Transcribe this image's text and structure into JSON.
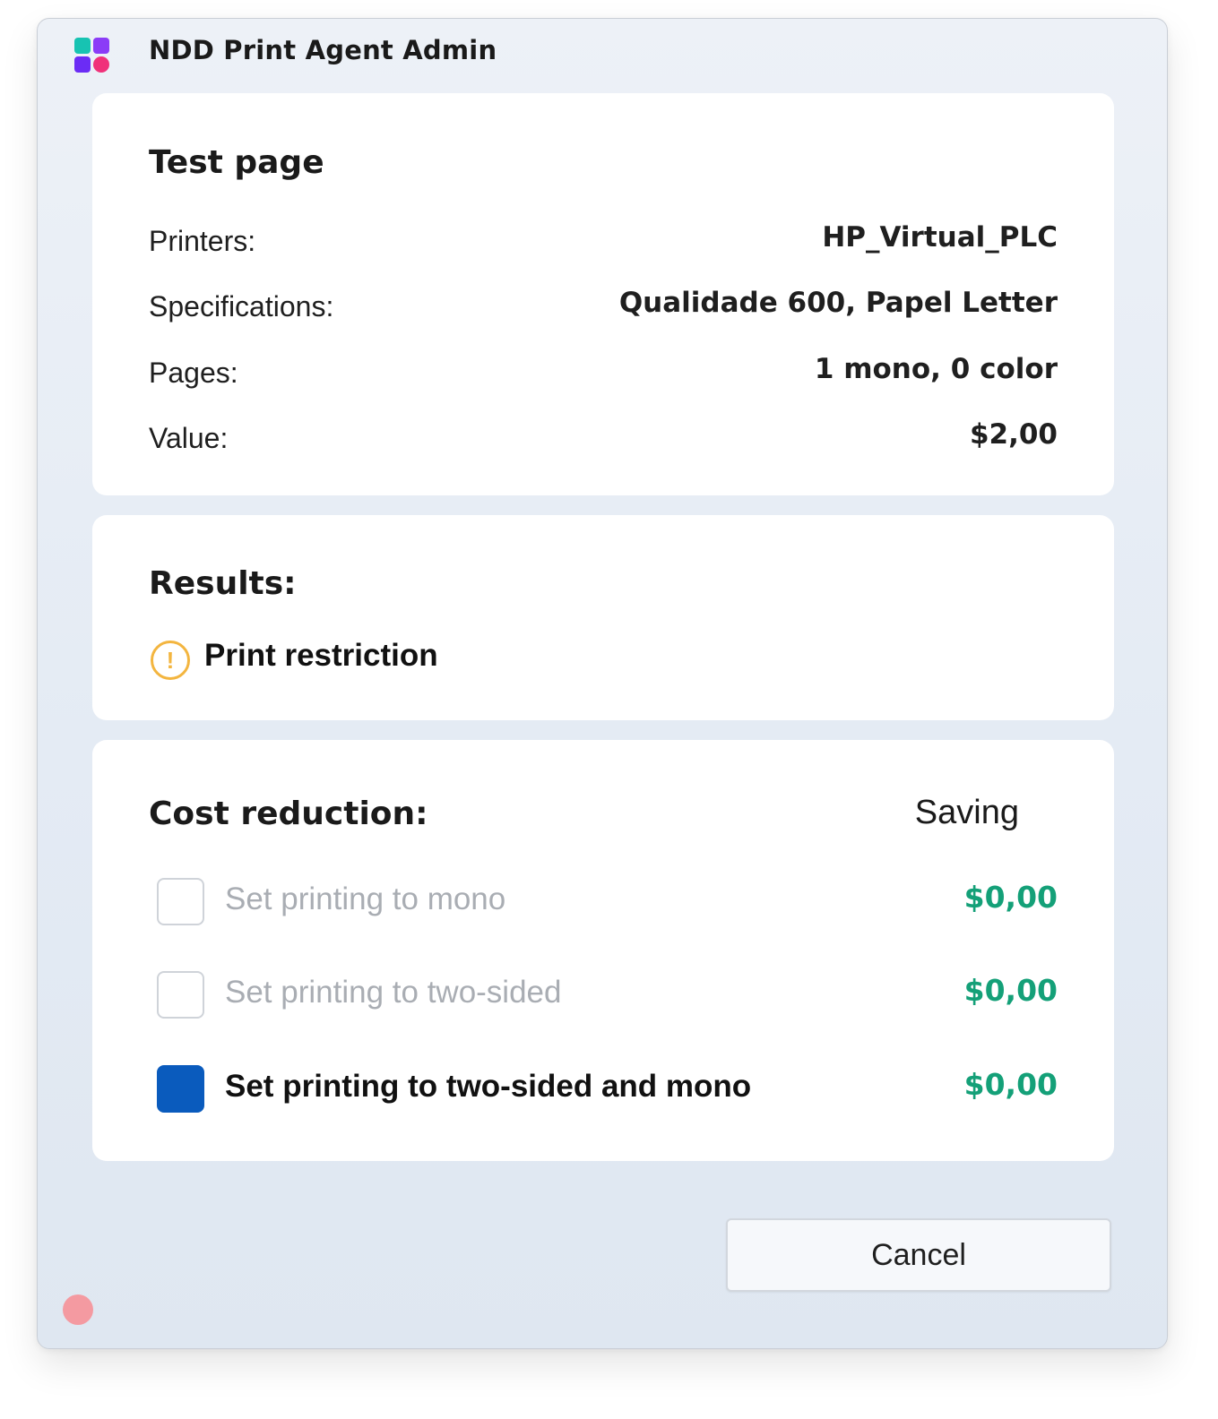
{
  "app": {
    "title": "NDD Print  Agent Admin",
    "icon": "ndd-logo-icon"
  },
  "test_page": {
    "title": "Test page",
    "rows": [
      {
        "label": "Printers:",
        "value": "HP_Virtual_PLC"
      },
      {
        "label": "Specifications:",
        "value": "Qualidade 600, Papel Letter"
      },
      {
        "label": "Pages:",
        "value": "1 mono, 0 color"
      },
      {
        "label": "Value:",
        "value": "$2,00"
      }
    ]
  },
  "results": {
    "title": "Results:",
    "icon": "warning-icon",
    "icon_glyph": "!",
    "status_text": "Print restriction",
    "status_color": "#f3b53f"
  },
  "cost_reduction": {
    "title": "Cost reduction:",
    "saving_header": "Saving",
    "options": [
      {
        "label": "Set printing to mono",
        "saving": "$0,00",
        "checked": false
      },
      {
        "label": "Set printing to two-sided",
        "saving": "$0,00",
        "checked": false
      },
      {
        "label": "Set printing to two-sided and mono",
        "saving": "$0,00",
        "checked": true
      }
    ],
    "saving_color": "#14a078",
    "checked_color": "#0a5bbd"
  },
  "actions": {
    "cancel_label": "Cancel"
  }
}
